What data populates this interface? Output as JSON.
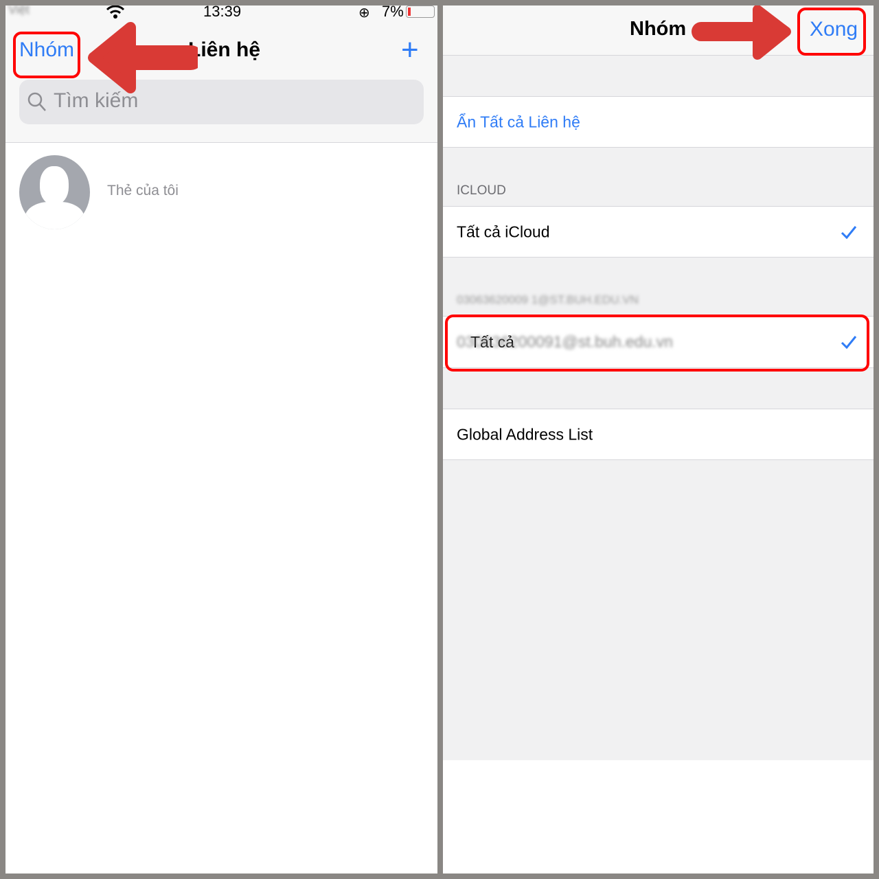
{
  "left": {
    "status": {
      "carrier": "Việt",
      "time": "13:39",
      "battery": "7%"
    },
    "nav": {
      "groups_button": "Nhóm",
      "title": "Liên hệ",
      "add_icon": "plus-icon"
    },
    "search": {
      "placeholder": "Tìm kiếm"
    },
    "my_card": {
      "label": "Thẻ của tôi"
    }
  },
  "right": {
    "nav": {
      "title": "Nhóm",
      "done_button": "Xong"
    },
    "hide_all": "Ẩn Tất cả Liên hệ",
    "sections": [
      {
        "header": "ICLOUD",
        "row": "Tất cả iCloud",
        "checked": true
      },
      {
        "header": "03063620009 1@ST.BUH.EDU.VN",
        "row_prefix": "Tất cả",
        "row_account": "030636200091@st.buh.edu.vn",
        "checked": true
      },
      {
        "header": "",
        "row": "Global Address List"
      }
    ]
  },
  "colors": {
    "accent": "#2f7cf6",
    "highlight": "#ff0000",
    "arrow": "#d93a35"
  }
}
